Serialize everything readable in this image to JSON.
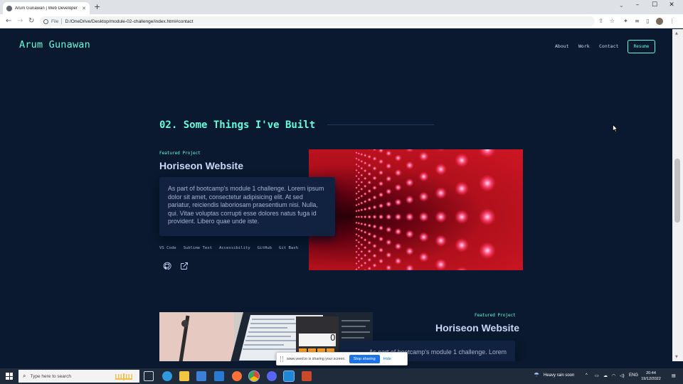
{
  "browser": {
    "tab_title": "Arum Gunawan | Web Developer",
    "new_tab": "+",
    "url_scheme": "File",
    "url": "D:/OneDrive/Desktop/module-02-challenge/index.html#contact",
    "minimize": "–",
    "maximize": "☐",
    "close": "✕"
  },
  "site": {
    "brand": "Arum Gunawan",
    "nav": [
      "About",
      "Work",
      "Contact"
    ],
    "resume": "Resume",
    "section_title": "02. Some Things I've Built"
  },
  "projects": [
    {
      "overline": "Featured Project",
      "title": "Horiseon Website",
      "description": "As part of bootcamp's module 1 challenge. Lorem ipsum dolor sit amet, consectetur adipisicing elit. At sed pariatur, reiciendis laboriosam praesentium nisi. Nulla, qui. Vitae voluptas corrupti esse dolores natus fuga id provident. Libero quae unde iste.",
      "tech": [
        "VS Code",
        "Sublime Text",
        "Accessibility",
        "GitHub",
        "Git Bash"
      ],
      "image": "red-led-lights"
    },
    {
      "overline": "Featured Project",
      "title": "Horiseon Website",
      "description": "As part of bootcamp's module 1 challenge. Lorem",
      "image": "laptop-workspace",
      "calc_display": "0"
    }
  ],
  "share_bar": {
    "message": "www.veed.io is sharing your screen.",
    "stop": "Stop sharing",
    "hide": "Hide"
  },
  "taskbar": {
    "search_placeholder": "Type here to search",
    "weather": "Heavy rain soon",
    "language": "ENG",
    "time": "20:44",
    "date": "19/12/2022"
  },
  "colors": {
    "background": "#0a192f",
    "accent": "#64ffda",
    "heading": "#ccd6f6",
    "panel": "#112240"
  }
}
